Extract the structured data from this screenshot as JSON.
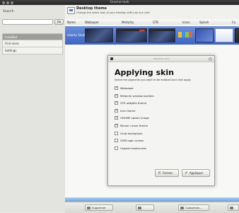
{
  "window": {
    "title": "Gnome-look"
  },
  "sidebar": {
    "search_label": "Search",
    "search_placeholder": "",
    "go_label": "Go",
    "items": [
      {
        "label": "Installed"
      },
      {
        "label": "Find more"
      },
      {
        "label": "Settings"
      }
    ]
  },
  "header": {
    "title": "Desktop theme",
    "subtitle": "Change the whole look of your desktop with just one click"
  },
  "columns": [
    "Name",
    "Wallpaper",
    "Metacity",
    "GTK",
    "Icons",
    "Splash",
    "Cu"
  ],
  "list": {
    "selected_row": "Liberty Studio"
  },
  "bottom_buttons": [
    {
      "label": "Supprimer",
      "icon": "delete-icon"
    },
    {
      "label": "",
      "icon": "info-icon"
    },
    {
      "label": "Customize...",
      "icon": "customize-icon"
    },
    {
      "label": "",
      "icon": "apply-icon"
    }
  ],
  "dialog": {
    "title": "Applying skin",
    "heading": "Applying skin",
    "description": "Select the pigments you want to be enabled and click apply",
    "options": [
      {
        "label": "Wallpaper",
        "checked": true
      },
      {
        "label": "Metacity window borders",
        "checked": true
      },
      {
        "label": "GTK widgets theme",
        "checked": true
      },
      {
        "label": "Icon theme",
        "checked": true
      },
      {
        "label": "GNOME splash image",
        "checked": true
      },
      {
        "label": "Mouse cursor theme",
        "checked": true
      },
      {
        "label": "Grub bootsplash",
        "checked": false
      },
      {
        "label": "GDM login screen",
        "checked": false
      },
      {
        "label": "Usplash bootscreen",
        "checked": false
      }
    ],
    "cancel_label": "Fermer",
    "apply_label": "Appliquer"
  },
  "colors": {
    "selection": "#3d64c3",
    "titlebar": "#2a2a2a",
    "apply_check": "#3d9a2d",
    "close_x": "#c0392b"
  }
}
